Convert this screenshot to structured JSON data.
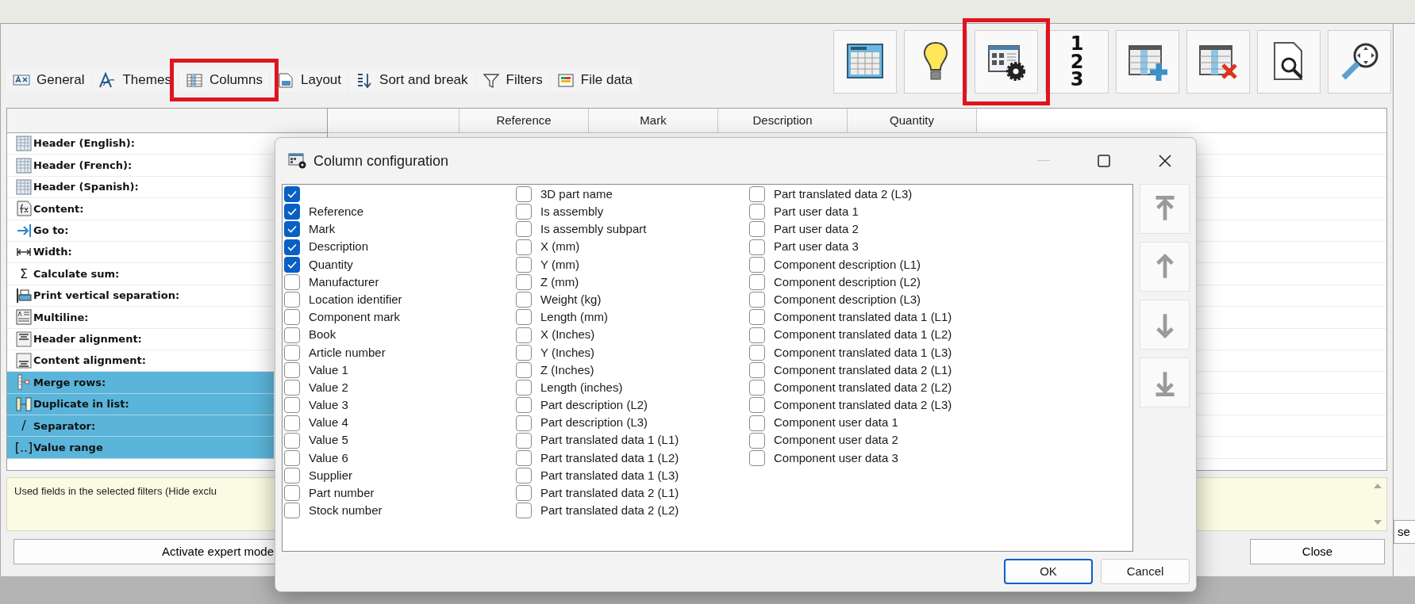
{
  "tabs": [
    {
      "label": "General",
      "kind": "general",
      "highlighted": false
    },
    {
      "label": "Themes",
      "kind": "themes",
      "highlighted": false
    },
    {
      "label": "Columns",
      "kind": "columns",
      "highlighted": true
    },
    {
      "label": "Layout",
      "kind": "layout",
      "highlighted": false
    },
    {
      "label": "Sort and break",
      "kind": "sort",
      "highlighted": false
    },
    {
      "label": "Filters",
      "kind": "filter",
      "highlighted": false
    },
    {
      "label": "File data",
      "kind": "filedata",
      "highlighted": false
    }
  ],
  "toolbar": [
    {
      "kind": "table",
      "highlighted": false
    },
    {
      "kind": "bulb",
      "highlighted": false
    },
    {
      "kind": "table-gear",
      "highlighted": true
    },
    {
      "kind": "numbering",
      "label": "123",
      "highlighted": false
    },
    {
      "kind": "table-plus",
      "highlighted": false
    },
    {
      "kind": "table-delete",
      "highlighted": false
    },
    {
      "kind": "preview",
      "highlighted": false
    },
    {
      "kind": "zoom",
      "highlighted": false
    }
  ],
  "properties": [
    {
      "label": "Header (English):",
      "kind": "table",
      "selected": false
    },
    {
      "label": "Header (French):",
      "kind": "table",
      "selected": false
    },
    {
      "label": "Header (Spanish):",
      "kind": "table",
      "selected": false
    },
    {
      "label": "Content:",
      "kind": "formula",
      "selected": false
    },
    {
      "label": "Go to:",
      "kind": "goto",
      "selected": false
    },
    {
      "label": "Width:",
      "kind": "width",
      "selected": false
    },
    {
      "label": "Calculate sum:",
      "kind": "symbol",
      "symbol": "Σ",
      "selected": false
    },
    {
      "label": "Print vertical separation:",
      "kind": "print",
      "selected": false
    },
    {
      "label": "Multiline:",
      "kind": "multiline",
      "selected": false
    },
    {
      "label": "Header alignment:",
      "kind": "align-top",
      "selected": false
    },
    {
      "label": "Content alignment:",
      "kind": "align-bottom",
      "selected": false
    },
    {
      "label": "Merge rows:",
      "kind": "merge",
      "selected": true
    },
    {
      "label": "Duplicate in list:",
      "kind": "duplicate",
      "selected": true
    },
    {
      "label": "Separator:",
      "kind": "symbol",
      "symbol": "/",
      "selected": true
    },
    {
      "label": "Value range",
      "kind": "symbol",
      "symbol": "[..]",
      "selected": true
    }
  ],
  "grid": {
    "columns": [
      "Reference",
      "Mark",
      "Description",
      "Quantity"
    ]
  },
  "info_text": "Used fields in the selected filters (Hide exclu",
  "expert_button": "Activate expert mode",
  "close_button": "Close",
  "background_button": "se",
  "dialog": {
    "title": "Column configuration",
    "items": [
      {
        "checked": true
      },
      {
        "label": "Reference",
        "checked": true
      },
      {
        "label": "Mark",
        "checked": true
      },
      {
        "label": "Description",
        "checked": true
      },
      {
        "label": "Quantity",
        "checked": true
      },
      {
        "label": "Manufacturer",
        "checked": false
      },
      {
        "label": "Location identifier",
        "checked": false
      },
      {
        "label": "Component mark",
        "checked": false
      },
      {
        "label": "Book",
        "checked": false
      },
      {
        "label": "Article number",
        "checked": false
      },
      {
        "label": "Value 1",
        "checked": false
      },
      {
        "label": "Value 2",
        "checked": false
      },
      {
        "label": "Value 3",
        "checked": false
      },
      {
        "label": "Value 4",
        "checked": false
      },
      {
        "label": "Value 5",
        "checked": false
      },
      {
        "label": "Value 6",
        "checked": false
      },
      {
        "label": "Supplier",
        "checked": false
      },
      {
        "label": "Part number",
        "checked": false
      },
      {
        "label": "Stock number",
        "checked": false
      },
      {
        "label": "3D part name",
        "checked": false
      },
      {
        "label": "Is assembly",
        "checked": false
      },
      {
        "label": "Is assembly subpart",
        "checked": false
      },
      {
        "label": "X (mm)",
        "checked": false
      },
      {
        "label": "Y (mm)",
        "checked": false
      },
      {
        "label": "Z (mm)",
        "checked": false
      },
      {
        "label": "Weight (kg)",
        "checked": false
      },
      {
        "label": "Length (mm)",
        "checked": false
      },
      {
        "label": "X (Inches)",
        "checked": false
      },
      {
        "label": "Y (Inches)",
        "checked": false
      },
      {
        "label": "Z (Inches)",
        "checked": false
      },
      {
        "label": "Length (inches)",
        "checked": false
      },
      {
        "label": "Part description (L2)",
        "checked": false
      },
      {
        "label": "Part description (L3)",
        "checked": false
      },
      {
        "label": "Part translated data 1 (L1)",
        "checked": false
      },
      {
        "label": "Part translated data 1 (L2)",
        "checked": false
      },
      {
        "label": "Part translated data 1 (L3)",
        "checked": false
      },
      {
        "label": "Part translated data 2 (L1)",
        "checked": false
      },
      {
        "label": "Part translated data 2 (L2)",
        "checked": false
      },
      {
        "label": "Part translated data 2 (L3)",
        "checked": false
      },
      {
        "label": "Part user data 1",
        "checked": false
      },
      {
        "label": "Part user data 2",
        "checked": false
      },
      {
        "label": "Part user data 3",
        "checked": false
      },
      {
        "label": "Component description (L1)",
        "checked": false
      },
      {
        "label": "Component description (L2)",
        "checked": false
      },
      {
        "label": "Component description (L3)",
        "checked": false
      },
      {
        "label": "Component translated data 1 (L1)",
        "checked": false
      },
      {
        "label": "Component translated data 1 (L2)",
        "checked": false
      },
      {
        "label": "Component translated data 1 (L3)",
        "checked": false
      },
      {
        "label": "Component translated data 2 (L1)",
        "checked": false
      },
      {
        "label": "Component translated data 2 (L2)",
        "checked": false
      },
      {
        "label": "Component translated data 2 (L3)",
        "checked": false
      },
      {
        "label": "Component user data 1",
        "checked": false
      },
      {
        "label": "Component user data 2",
        "checked": false
      },
      {
        "label": "Component user data 3",
        "checked": false
      }
    ],
    "move_buttons": [
      {
        "kind": "top"
      },
      {
        "kind": "up"
      },
      {
        "kind": "down"
      },
      {
        "kind": "bottom"
      }
    ],
    "buttons": [
      {
        "label": "OK",
        "default": true
      },
      {
        "label": "Cancel",
        "default": false
      }
    ]
  }
}
